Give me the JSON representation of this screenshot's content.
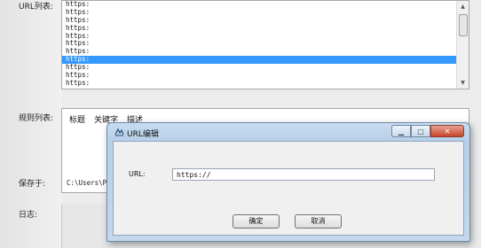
{
  "labels": {
    "url_list": "URL列表:",
    "rule_list": "规则列表:",
    "save_to": "保存于:",
    "log": "日志:"
  },
  "url_list": {
    "items": [
      "https:",
      "https:",
      "https:",
      "https:",
      "https:",
      "https:",
      "https:",
      "https:",
      "https:",
      "https:",
      "https:"
    ],
    "selected_index": 7
  },
  "rule_list": {
    "headers": [
      "标题",
      "关键字",
      "描述"
    ]
  },
  "save_path": "C:\\Users\\PC",
  "dialog": {
    "title": "URL编辑",
    "url_label": "URL:",
    "url_value": "https://",
    "ok_label": "确定",
    "cancel_label": "取消"
  },
  "colors": {
    "selection": "#3399ff",
    "close_button": "#c7442a"
  }
}
